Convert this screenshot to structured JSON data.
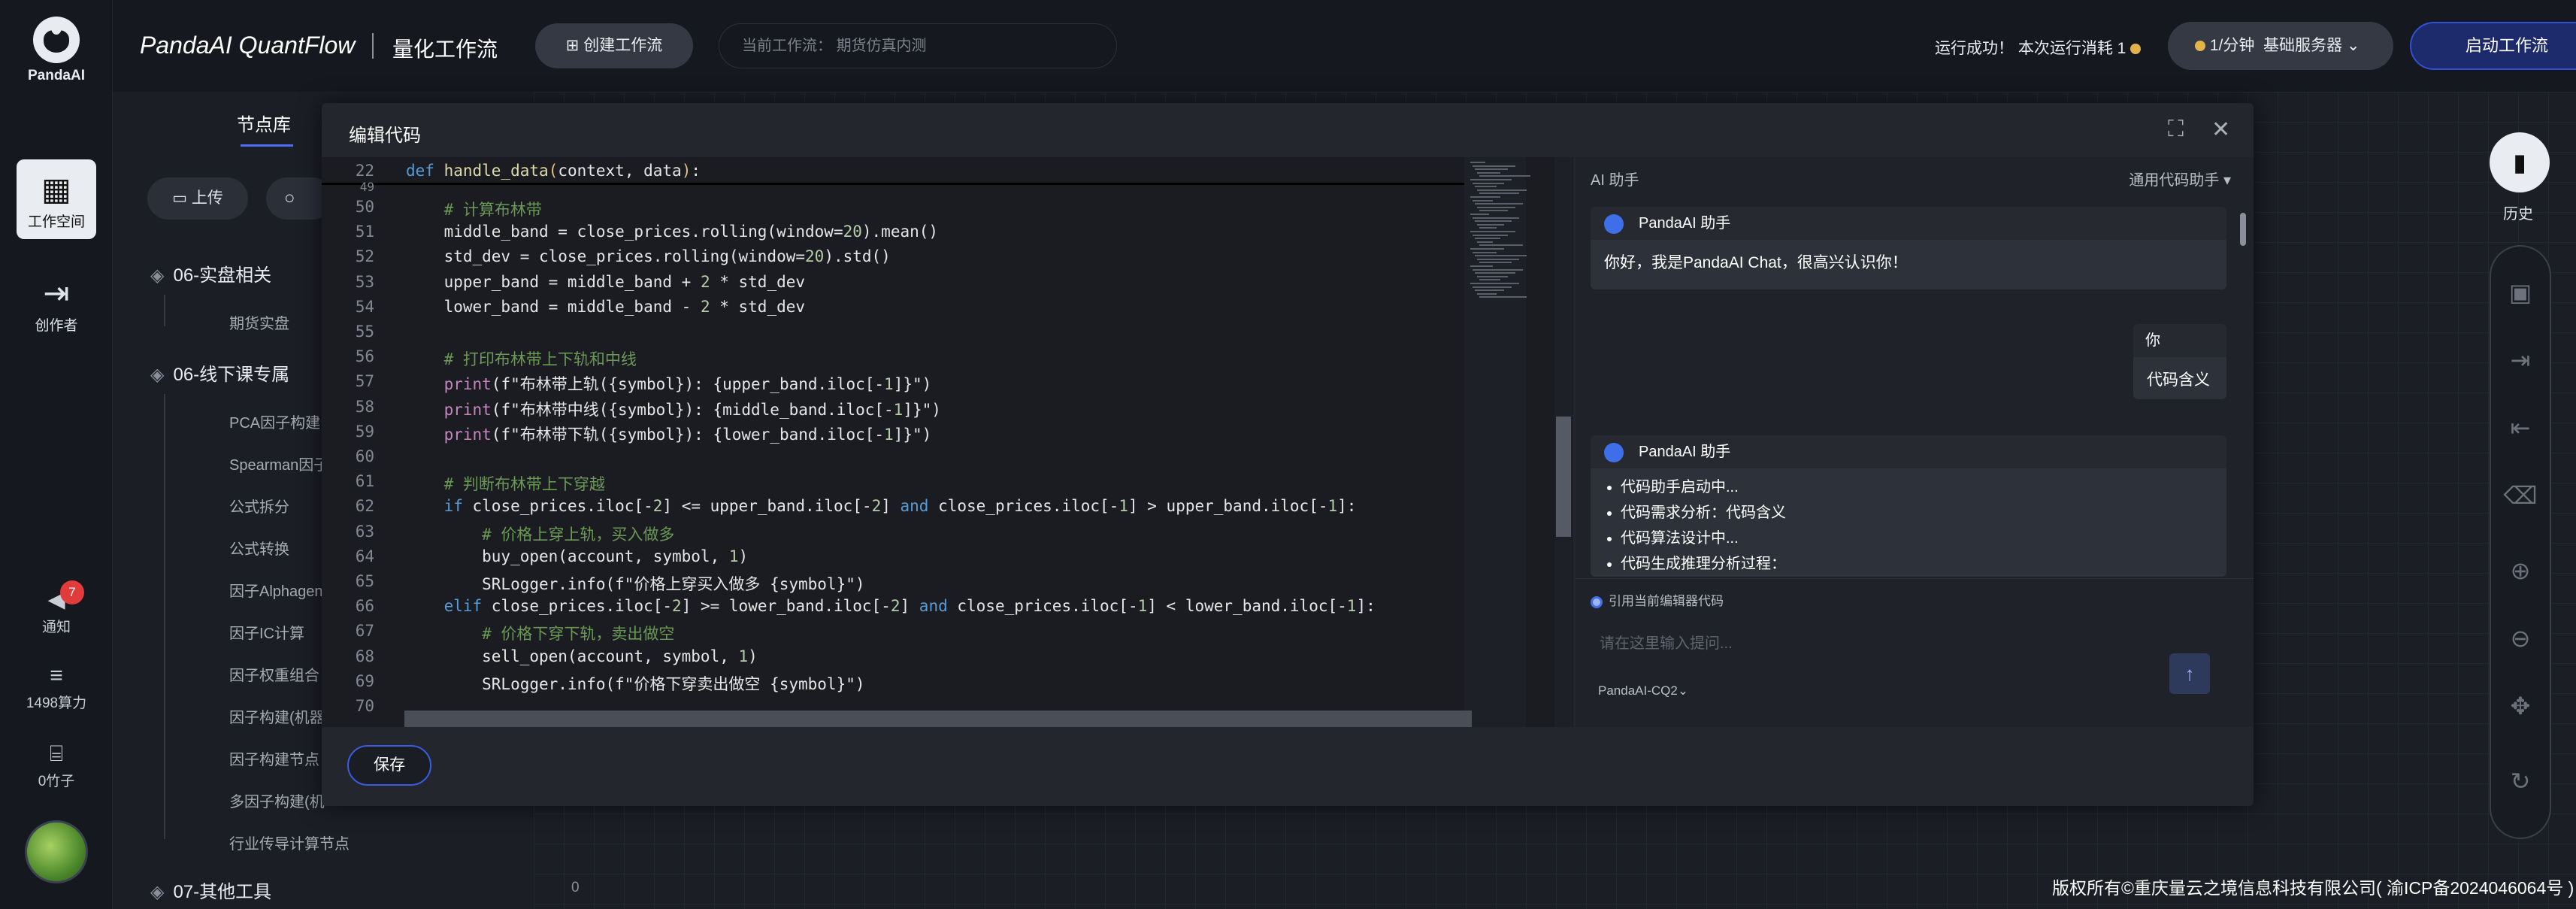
{
  "app": {
    "logo_text": "PandaAI"
  },
  "rail": {
    "workspace": "工作空间",
    "creator": "创作者",
    "notify": "通知",
    "notify_count": "7",
    "compute": "1498算力",
    "bamboo": "0竹子"
  },
  "topbar": {
    "brand": "PandaAI QuantFlow",
    "subtitle": "量化工作流",
    "create_btn": "创建工作流",
    "current_flow_label": "当前工作流：",
    "current_flow_value": "期货仿真内测",
    "run_status": "运行成功！ 本次运行消耗 1",
    "server_rate": "1/分钟",
    "server_name": "基础服务器",
    "start_btn": "启动工作流"
  },
  "library": {
    "tab": "节点库",
    "upload": "上传",
    "categories": [
      {
        "name": "06-实盘相关",
        "items": [
          "期货实盘"
        ]
      },
      {
        "name": "06-线下课专属",
        "items": [
          "PCA因子构建",
          "Spearman因子",
          "公式拆分",
          "公式转换",
          "因子Alphagen",
          "因子IC计算",
          "因子权重组合",
          "因子构建(机器",
          "因子构建节点",
          "多因子构建(机",
          "行业传导计算节点"
        ]
      },
      {
        "name": "07-其他工具",
        "items": []
      }
    ],
    "zero": "0"
  },
  "modal": {
    "title": "编辑代码",
    "save": "保存",
    "sticky_line": {
      "num": "22",
      "code": "def handle_data(context, data):"
    },
    "code_lines": [
      {
        "num": "49",
        "code": ""
      },
      {
        "num": "50",
        "code": "    # 计算布林带"
      },
      {
        "num": "51",
        "code": "    middle_band = close_prices.rolling(window=20).mean()"
      },
      {
        "num": "52",
        "code": "    std_dev = close_prices.rolling(window=20).std()"
      },
      {
        "num": "53",
        "code": "    upper_band = middle_band + 2 * std_dev"
      },
      {
        "num": "54",
        "code": "    lower_band = middle_band - 2 * std_dev"
      },
      {
        "num": "55",
        "code": ""
      },
      {
        "num": "56",
        "code": "    # 打印布林带上下轨和中线"
      },
      {
        "num": "57",
        "code": "    print(f\"布林带上轨({symbol}): {upper_band.iloc[-1]}\")"
      },
      {
        "num": "58",
        "code": "    print(f\"布林带中线({symbol}): {middle_band.iloc[-1]}\")"
      },
      {
        "num": "59",
        "code": "    print(f\"布林带下轨({symbol}): {lower_band.iloc[-1]}\")"
      },
      {
        "num": "60",
        "code": ""
      },
      {
        "num": "61",
        "code": "    # 判断布林带上下穿越"
      },
      {
        "num": "62",
        "code": "    if close_prices.iloc[-2] <= upper_band.iloc[-2] and close_prices.iloc[-1] > upper_band.iloc[-1]:"
      },
      {
        "num": "63",
        "code": "        # 价格上穿上轨，买入做多"
      },
      {
        "num": "64",
        "code": "        buy_open(account, symbol, 1)"
      },
      {
        "num": "65",
        "code": "        SRLogger.info(f\"价格上穿买入做多 {symbol}\")"
      },
      {
        "num": "66",
        "code": "    elif close_prices.iloc[-2] >= lower_band.iloc[-2] and close_prices.iloc[-1] < lower_band.iloc[-1]:"
      },
      {
        "num": "67",
        "code": "        # 价格下穿下轨，卖出做空"
      },
      {
        "num": "68",
        "code": "        sell_open(account, symbol, 1)"
      },
      {
        "num": "69",
        "code": "        SRLogger.info(f\"价格下穿卖出做空 {symbol}\")"
      },
      {
        "num": "70",
        "code": ""
      }
    ]
  },
  "ai": {
    "title": "AI 助手",
    "assistant_select": "通用代码助手",
    "bot_name": "PandaAI 助手",
    "greeting": "你好，我是PandaAI Chat，很高兴认识你！",
    "user_name": "你",
    "user_msg": "代码含义",
    "steps": [
      "代码助手启动中...",
      "代码需求分析：代码含义",
      "代码算法设计中...",
      "代码生成推理分析过程："
    ],
    "ref_label": "引用当前编辑器代码",
    "input_placeholder": "请在这里输入提问...",
    "model": "PandaAI-CQ2"
  },
  "right_tools": {
    "history": "历史"
  },
  "footer": "版权所有©重庆量云之境信息科技有限公司( 渝ICP备2024046064号 )",
  "colors": {
    "accent": "#3f6fe8",
    "background": "#111318",
    "panel": "#23262d",
    "notify_badge": "#e23b3b"
  }
}
